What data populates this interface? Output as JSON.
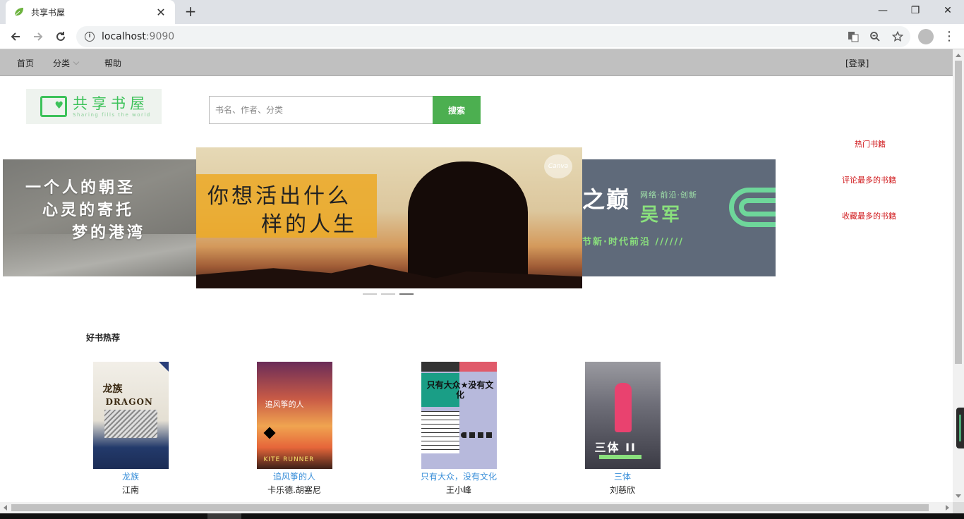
{
  "browser": {
    "tab_title": "共享书屋",
    "tab_close": "✕",
    "new_tab": "+",
    "url_host": "localhost",
    "url_port": ":9090",
    "window_controls": [
      "—",
      "❐",
      "✕"
    ]
  },
  "nav": {
    "home": "首页",
    "category": "分类",
    "help": "帮助",
    "login": "[登录]"
  },
  "header": {
    "logo_cn": "共享书屋",
    "logo_en": "Sharing fills the world",
    "search_placeholder": "书名、作者、分类",
    "search_button": "搜索"
  },
  "carousel": {
    "left_slide": [
      "一个人的朝圣",
      "心灵的寄托",
      "梦的港湾"
    ],
    "center_slide": [
      "你想活出什么",
      "样的人生"
    ],
    "center_badge": "Canva",
    "right_slide": {
      "big": "之巅",
      "small": "网络·前沿·创新",
      "name": "吴军",
      "motto": "节新·时代前沿  //////"
    },
    "active_index": 2
  },
  "side_links": [
    "热门书籍",
    "评论最多的书籍",
    "收藏最多的书籍"
  ],
  "recommend": {
    "title": "好书热荐",
    "books": [
      {
        "name": "龙族",
        "author": "江南",
        "cover_text": "龙族",
        "cover_sub": "DRAGON"
      },
      {
        "name": "追风筝的人",
        "author": "卡乐德.胡塞尼",
        "cover_text": "追风筝的人",
        "cover_sub": "KITE RUNNER"
      },
      {
        "name": "只有大众，没有文化",
        "author": "王小峰",
        "cover_text": "只有大众★没有文化"
      },
      {
        "name": "三体",
        "author": "刘慈欣",
        "cover_text": "三体 II"
      }
    ]
  },
  "colors": {
    "accent_green": "#4caf50",
    "nav_bg": "#c0c0c0",
    "side_link_red": "#d0181b",
    "book_link_blue": "#3a8fd9"
  }
}
